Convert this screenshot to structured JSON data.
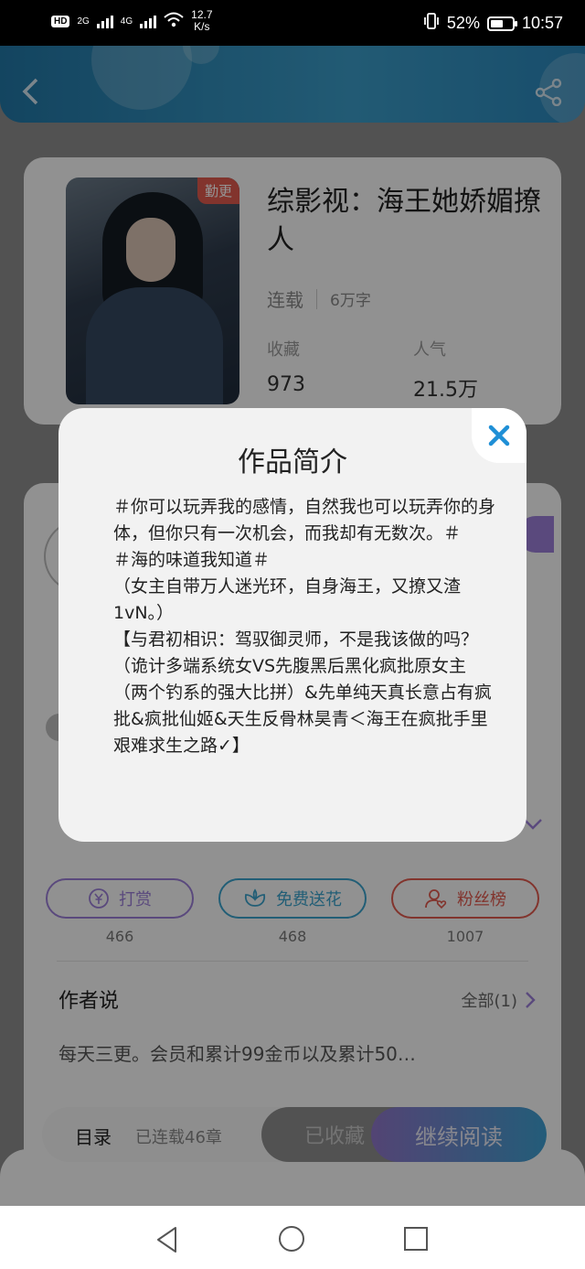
{
  "status_bar": {
    "hd_label": "HD",
    "net_2": "2G",
    "net_4": "4G",
    "speed": "12.7",
    "speed_unit": "K/s",
    "battery": "52%",
    "time": "10:57"
  },
  "header": {
    "back_icon": "chevron-left-icon",
    "share_icon": "share-icon",
    "accent": "#2f8fc0"
  },
  "book": {
    "badge": "勤更",
    "title": "综影视：海王她娇媚撩人",
    "status": "连载",
    "words": "6万字",
    "stats": [
      {
        "label": "收藏",
        "value": "973"
      },
      {
        "label": "人气",
        "value": "21.5万"
      }
    ]
  },
  "actions": [
    {
      "label": "打赏",
      "count": "466",
      "icon": "coin-icon",
      "color": "#9b7fd8"
    },
    {
      "label": "免费送花",
      "count": "468",
      "icon": "flower-icon",
      "color": "#3ba3cc"
    },
    {
      "label": "粉丝榜",
      "count": "1007",
      "icon": "fans-icon",
      "color": "#e05a4e"
    }
  ],
  "author_say": {
    "title": "作者说",
    "more": "全部(1)",
    "text": "每天三更。会员和累计99金币以及累计50…"
  },
  "bottom_bar": {
    "toc": "目录",
    "toc_count": "已连载46章",
    "collected": "已收藏",
    "continue": "继续阅读"
  },
  "modal": {
    "title": "作品简介",
    "close_icon": "close-icon",
    "paragraphs": [
      "＃你可以玩弄我的感情，自然我也可以玩弄你的身体，但你只有一次机会，而我却有无数次。＃",
      "＃海的味道我知道＃",
      "（女主自带万人迷光环，自身海王，又撩又渣1vN。）",
      "【与君初相识：驾驭御灵师，不是我该做的吗？（诡计多端系统女VS先腹黑后黑化疯批原女主（两个钓系的强大比拼）&先单纯天真长意占有疯批&疯批仙姬&天生反骨林昊青＜海王在疯批手里艰难求生之路✓】"
    ]
  },
  "nav": {
    "back_icon": "nav-back-icon",
    "home_icon": "nav-home-icon",
    "recent_icon": "nav-recent-icon"
  }
}
